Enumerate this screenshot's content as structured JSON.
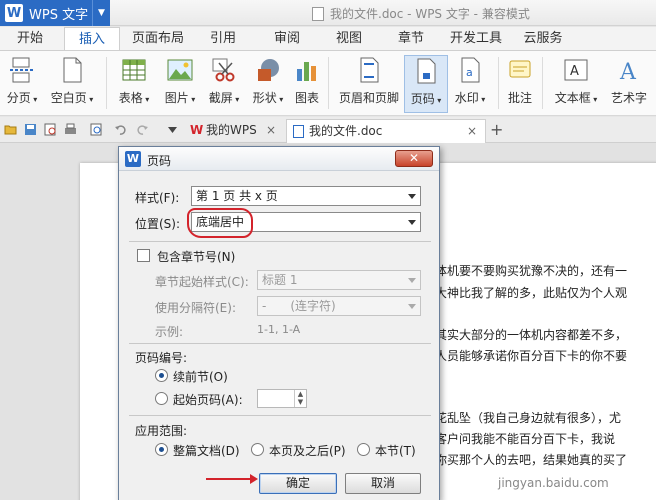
{
  "app": {
    "name": "WPS 文字",
    "window_title": "我的文件.doc - WPS 文字 - 兼容模式"
  },
  "menu_tabs": [
    "开始",
    "插入",
    "页面布局",
    "引用",
    "审阅",
    "视图",
    "章节",
    "开发工具",
    "云服务"
  ],
  "active_menu": "插入",
  "ribbon": {
    "page_break": "分页",
    "blank_page": "空白页",
    "table": "表格",
    "picture": "图片",
    "screenshot": "截屏",
    "shape": "形状",
    "chart": "图表",
    "header_footer": "页眉和页脚",
    "page_number": "页码",
    "watermark": "水印",
    "comment": "批注",
    "textbox": "文本框",
    "wordart": "艺术字"
  },
  "doc_tabs": [
    {
      "label": "我的WPS",
      "close": "×"
    },
    {
      "label": "我的文件.doc",
      "close": "×"
    }
  ],
  "new_tab": "+",
  "document_lines": [
    "体机要不要购买犹豫不决的，还有一",
    "大神比我了解的多，此贴仅为个人观",
    "其实大部分的一体机内容都差不多，",
    "人员能够承诺你百分百下卡的你不要",
    "花乱坠（我自己身边就有很多），尤",
    "客户问我能不能百分百下卡，我说",
    "你买那个人的去吧，结果她真的买了"
  ],
  "dialog": {
    "title": "页码",
    "close": "✕",
    "style_label": "样式(F):",
    "style_value": "第 1 页 共 x 页",
    "position_label": "位置(S):",
    "position_value": "底端居中",
    "include_chapter": "包含章节号(N)",
    "chapter_start_label": "章节起始样式(C):",
    "chapter_start_value": "标题 1",
    "separator_label": "使用分隔符(E):",
    "separator_value": "-　　(连字符)",
    "example_label": "示例:",
    "example_value": "1-1, 1-A",
    "numbering_title": "页码编号:",
    "continue": "续前节(O)",
    "start_at": "起始页码(A):",
    "range_title": "应用范围:",
    "whole_doc": "整篇文档(D)",
    "this_and_after": "本页及之后(P)",
    "this_section": "本节(T)",
    "ok": "确定",
    "cancel": "取消"
  },
  "watermark_text": "jingyan.baidu.com",
  "colors": {
    "accent": "#2b6bc4",
    "annotation": "#d3232b"
  }
}
